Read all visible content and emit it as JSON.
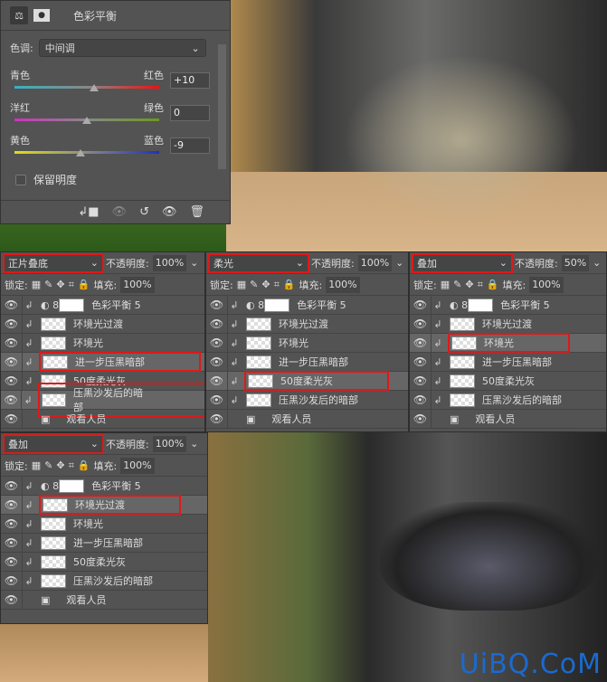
{
  "properties": {
    "title": "色彩平衡",
    "tone_label": "色调:",
    "tone_value": "中间调",
    "sliders": [
      {
        "left": "青色",
        "right": "红色",
        "value": "+10",
        "level": 10
      },
      {
        "left": "洋红",
        "right": "绿色",
        "value": "0",
        "level": 0
      },
      {
        "left": "黄色",
        "right": "蓝色",
        "value": "-9",
        "level": -9
      }
    ],
    "preserve_luminosity": "保留明度",
    "preserve_checked": false
  },
  "panels": [
    {
      "blend": "正片叠底",
      "opacity_label": "不透明度:",
      "opacity": "100%",
      "lock_label": "锁定:",
      "fill_label": "填充:",
      "fill": "100%",
      "layers": [
        "色彩平衡 5",
        "环境光过渡",
        "环境光",
        "进一步压黑暗部",
        "50度柔光灰",
        "压黑沙发后的暗部",
        "观看人员"
      ],
      "highlighted": [
        3,
        5
      ]
    },
    {
      "blend": "柔光",
      "opacity_label": "不透明度:",
      "opacity": "100%",
      "lock_label": "锁定:",
      "fill_label": "填充:",
      "fill": "100%",
      "layers": [
        "色彩平衡 5",
        "环境光过渡",
        "环境光",
        "进一步压黑暗部",
        "50度柔光灰",
        "压黑沙发后的暗部",
        "观看人员"
      ],
      "highlighted": [
        4
      ]
    },
    {
      "blend": "叠加",
      "opacity_label": "不透明度:",
      "opacity": "50%",
      "lock_label": "锁定:",
      "fill_label": "填充:",
      "fill": "100%",
      "layers": [
        "色彩平衡 5",
        "环境光过渡",
        "环境光",
        "进一步压黑暗部",
        "50度柔光灰",
        "压黑沙发后的暗部",
        "观看人员"
      ],
      "highlighted": [
        2
      ]
    },
    {
      "blend": "叠加",
      "opacity_label": "不透明度:",
      "opacity": "100%",
      "lock_label": "锁定:",
      "fill_label": "填充:",
      "fill": "100%",
      "layers": [
        "色彩平衡 5",
        "环境光过渡",
        "环境光",
        "进一步压黑暗部",
        "50度柔光灰",
        "压黑沙发后的暗部",
        "观看人员"
      ],
      "highlighted": [
        1
      ]
    }
  ],
  "watermark": "UiBQ.CoM",
  "colors": {
    "highlight": "#e01818",
    "panel": "#535353",
    "watermark": "#1a6ad0"
  }
}
